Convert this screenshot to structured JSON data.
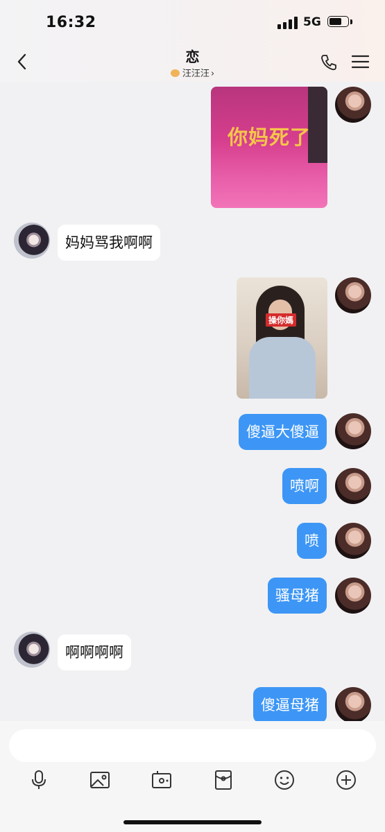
{
  "status_bar": {
    "time": "16:32",
    "network": "5G"
  },
  "header": {
    "title": "恋",
    "subtitle": "汪汪汪",
    "icons": [
      "back-icon",
      "phone-icon",
      "menu-icon"
    ]
  },
  "messages": [
    {
      "from": "me",
      "type": "image",
      "overlay_text": "你妈死了"
    },
    {
      "from": "them",
      "type": "text",
      "text": "妈妈骂我啊啊"
    },
    {
      "from": "me",
      "type": "image",
      "overlay_text": "操你媽"
    },
    {
      "from": "me",
      "type": "text",
      "text": "傻逼大傻逼"
    },
    {
      "from": "me",
      "type": "text",
      "text": "喷啊"
    },
    {
      "from": "me",
      "type": "text",
      "text": "喷"
    },
    {
      "from": "me",
      "type": "text",
      "text": "骚母猪"
    },
    {
      "from": "them",
      "type": "text",
      "text": "啊啊啊啊"
    },
    {
      "from": "me",
      "type": "text",
      "text": "傻逼母猪"
    }
  ],
  "input": {
    "placeholder": ""
  },
  "toolbar": [
    "microphone-icon",
    "image-icon",
    "camera-icon",
    "red-packet-icon",
    "emoji-icon",
    "plus-icon"
  ],
  "colors": {
    "my_bubble": "#3d96f5",
    "their_bubble": "#ffffff",
    "background": "#f1f1f3"
  }
}
